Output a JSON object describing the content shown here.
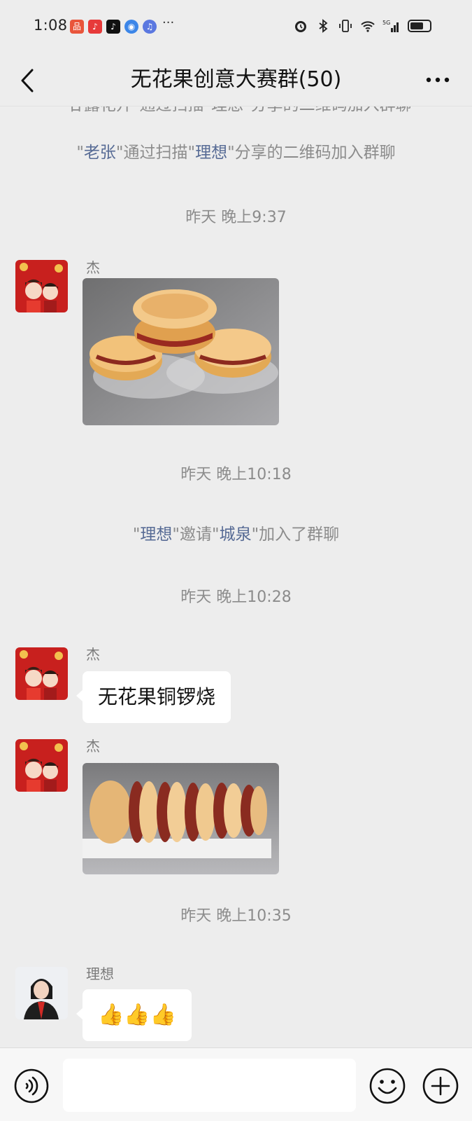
{
  "status": {
    "time": "1:08",
    "more": "···"
  },
  "header": {
    "title": "无花果创意大赛群(50)"
  },
  "chat": {
    "cut_notice": "\"甘露花开\"通过扫描\"理想\"分享的二维码加入群聊",
    "join_notice": {
      "q1": "\"",
      "name": "老张",
      "mid": "\"通过扫描\"",
      "inviter": "理想",
      "end": "\"分享的二维码加入群聊"
    },
    "times": [
      "昨天 晚上9:37",
      "昨天 晚上10:18",
      "昨天 晚上10:28",
      "昨天 晚上10:35"
    ],
    "invite_notice": {
      "q1": "\"",
      "inviter": "理想",
      "mid": "\"邀请\"",
      "invitee": "城泉",
      "end": "\"加入了群聊"
    },
    "messages": [
      {
        "sender": "杰",
        "type": "image",
        "alt": "无花果铜锣烧"
      },
      {
        "sender": "杰",
        "type": "text",
        "text": "无花果铜锣烧"
      },
      {
        "sender": "杰",
        "type": "image",
        "alt": "一排铜锣烧"
      },
      {
        "sender": "理想",
        "type": "emoji",
        "text": "👍👍👍"
      }
    ]
  },
  "input": {
    "placeholder": ""
  },
  "colors": {
    "background": "#ededed",
    "name_link": "#576b95",
    "system_text": "#8c8c8c",
    "bubble": "#ffffff"
  },
  "icons": [
    "back-arrow-icon",
    "more-dots-icon",
    "voice-icon",
    "emoji-icon",
    "plus-icon"
  ]
}
